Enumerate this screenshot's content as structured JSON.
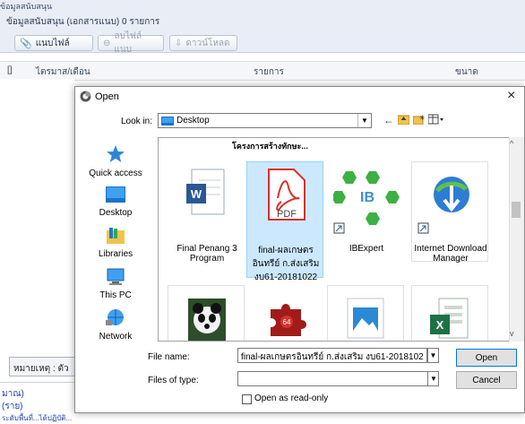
{
  "app": {
    "top_text": "ข้อมูลสนับสนุน",
    "panel_title": "ข้อมูลสนับสนุน (เอกสารแนบ) 0 รายการ",
    "toolbar": {
      "attach_label": "แนบไฟล์",
      "delete_label": "ลบไฟล์แนบ",
      "download_label": "ดาวน์โหลด"
    },
    "table_headers": [
      "[]",
      "ไตรมาส/เดือน",
      "รายการ",
      "ขนาด"
    ],
    "note_label": "หมายเหตุ : ตัว",
    "bottom_lines": [
      "มาณ)",
      "(ราย)",
      "ระดับพื้นที่...ได้ปฏิบัติ..."
    ]
  },
  "dialog": {
    "title": "Open",
    "close_symbol": "×",
    "look_in_label": "Look in:",
    "look_in_value": "Desktop",
    "places": [
      {
        "label": "Quick access",
        "icon": "star-icon"
      },
      {
        "label": "Desktop",
        "icon": "desktop-icon"
      },
      {
        "label": "Libraries",
        "icon": "libraries-icon"
      },
      {
        "label": "This PC",
        "icon": "computer-icon"
      },
      {
        "label": "Network",
        "icon": "network-icon"
      }
    ],
    "files_top_label": "โครงการสร้างทักษะ...",
    "files": [
      {
        "label": "Final Penang 3 Program",
        "icon": "word-icon",
        "selected": false
      },
      {
        "label": "final-ผลเกษตรอินทรีย์ ก.ส่งเสริม งบ61-20181022",
        "icon": "pdf-icon",
        "selected": true
      },
      {
        "label": "IBExpert",
        "icon": "ibexpert-icon",
        "selected": false
      },
      {
        "label": "Internet Download Manager",
        "icon": "idm-icon",
        "selected": false
      },
      {
        "label": "",
        "icon": "panda-icon",
        "selected": false
      },
      {
        "label": "",
        "icon": "puzzle-icon",
        "selected": false
      },
      {
        "label": "",
        "icon": "image-file-icon",
        "selected": false
      },
      {
        "label": "",
        "icon": "excel-icon",
        "selected": false
      }
    ],
    "pdf_badge": "PDF",
    "word_badge": "W",
    "excel_badge": "X",
    "puzzle_badge": "64",
    "file_name_label": "File name:",
    "file_name_value": "final-ผลเกษตรอินทรีย์ ก.ส่งเสริม งบ61-2018102",
    "files_of_type_label": "Files of type:",
    "files_of_type_value": "",
    "readonly_label": "Open as read-only",
    "open_button": "Open",
    "cancel_button": "Cancel",
    "colors": {
      "accent": "#0078d7",
      "selection": "#cce8ff",
      "pdf_red": "#d9302c",
      "word_blue": "#2b5797",
      "excel_green": "#1e7145"
    }
  }
}
